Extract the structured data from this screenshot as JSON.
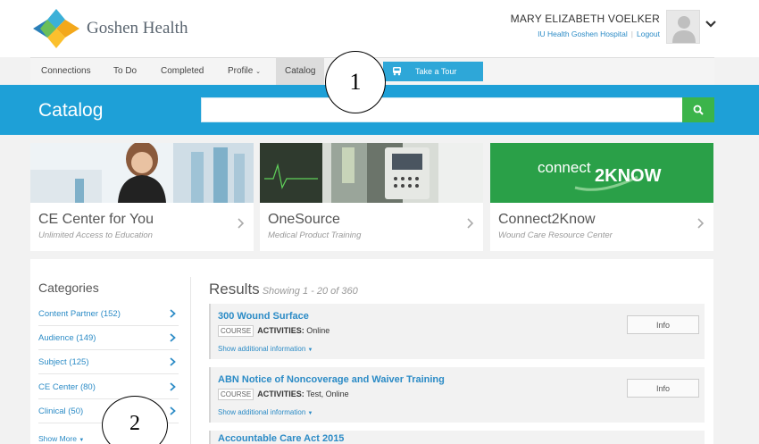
{
  "header": {
    "logo_text": "Goshen Health",
    "user_name": "MARY ELIZABETH VOELKER",
    "org_link": "IU Health Goshen Hospital",
    "logout_link": "Logout"
  },
  "nav": {
    "items": [
      "Connections",
      "To Do",
      "Completed",
      "Profile",
      "Catalog"
    ],
    "tour_button": "Take a Tour"
  },
  "catalog": {
    "title": "Catalog",
    "search_placeholder": ""
  },
  "tiles": [
    {
      "title": "CE Center for You",
      "subtitle": "Unlimited Access to Education"
    },
    {
      "title": "OneSource",
      "subtitle": "Medical Product Training"
    },
    {
      "title": "Connect2Know",
      "subtitle": "Wound Care Resource Center",
      "banner_prefix": "connect",
      "banner_main": "2KNOW"
    }
  ],
  "categories": {
    "heading": "Categories",
    "items": [
      "Content Partner (152)",
      "Audience (149)",
      "Subject (125)",
      "CE Center (80)",
      "Clinical (50)"
    ],
    "show_more": "Show More"
  },
  "results": {
    "heading": "Results",
    "showing": "Showing 1 - 20 of 360",
    "items": [
      {
        "title": "300 Wound Surface",
        "badge": "COURSE",
        "activities_label": "ACTIVITIES:",
        "activities": "Online",
        "more": "Show additional information",
        "button": "Info"
      },
      {
        "title": "ABN Notice of Noncoverage and Waiver Training",
        "badge": "COURSE",
        "activities_label": "ACTIVITIES:",
        "activities": "Test, Online",
        "more": "Show additional information",
        "button": "Info"
      },
      {
        "title": "Accountable Care Act 2015"
      }
    ]
  },
  "annotations": [
    "1",
    "2"
  ],
  "colors": {
    "brand_blue": "#1ea0d7",
    "link": "#2b8bc6",
    "green": "#3bb44a"
  }
}
